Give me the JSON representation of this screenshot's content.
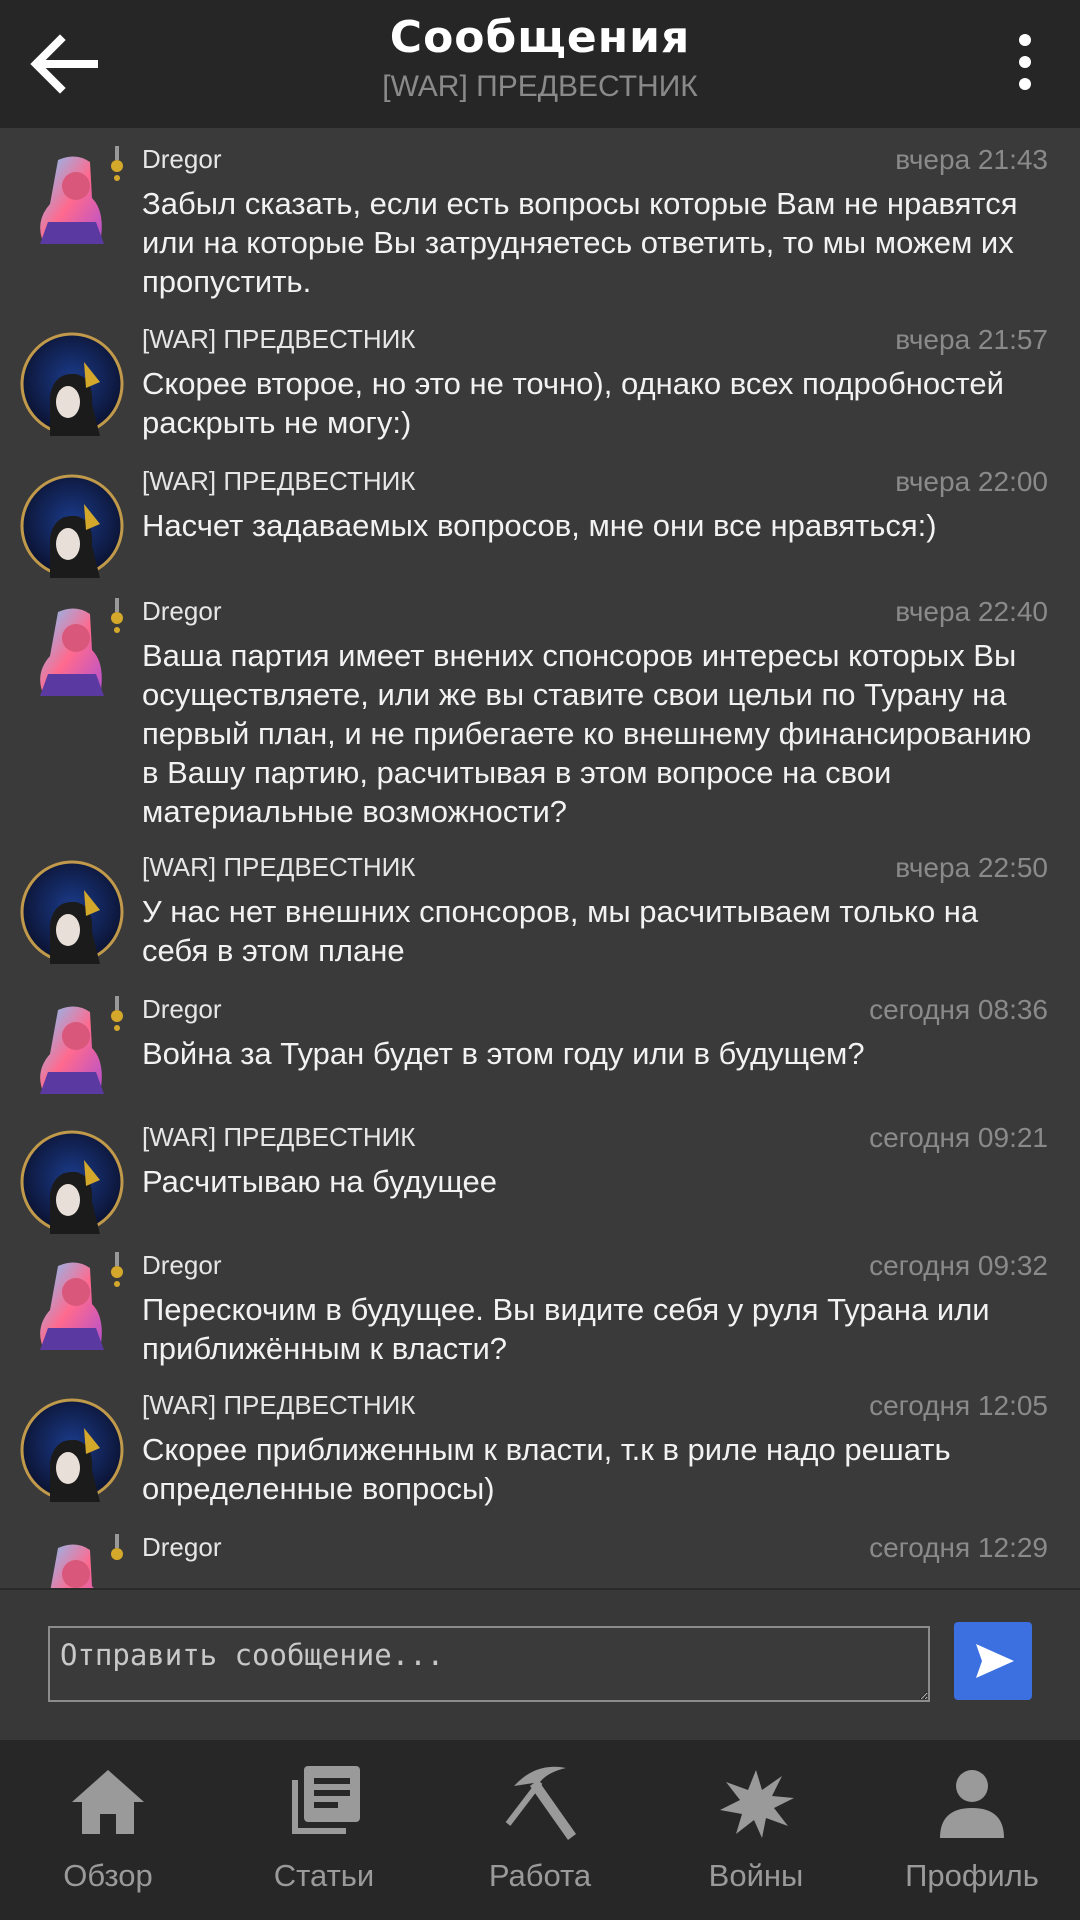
{
  "header": {
    "title": "Сообщения",
    "subtitle": "[WAR] ПРЕДВЕСТНИК",
    "back_icon": "arrow-left-icon",
    "menu_icon": "more-vertical-icon"
  },
  "messages": [
    {
      "author": "Dregor",
      "time": "вчера 21:43",
      "text": "Забыл сказать, если есть вопросы которые Вам не нравятся или на которые Вы затрудняетесь ответить, то мы можем их пропустить."
    },
    {
      "author": "[WAR] ПРЕДВЕСТНИК",
      "time": "вчера 21:57",
      "text": "Скорее второе, но это не точно), однако всех подробностей раскрыть не могу:)"
    },
    {
      "author": "[WAR] ПРЕДВЕСТНИК",
      "time": "вчера 22:00",
      "text": "Насчет задаваемых вопросов, мне они все нравяться:)"
    },
    {
      "author": "Dregor",
      "time": "вчера 22:40",
      "text": "Ваша партия имеет внених спонсоров интересы которых Вы осуществляете, или же вы ставите свои цельи по Турану на первый план, и не прибегаете ко внешнему финансированию в Вашу партию, расчитывая в этом вопросе на свои материальные возможности?"
    },
    {
      "author": "[WAR] ПРЕДВЕСТНИК",
      "time": "вчера 22:50",
      "text": "У нас нет внешних спонсоров, мы расчитываем только на себя в этом плане"
    },
    {
      "author": "Dregor",
      "time": "сегодня 08:36",
      "text": "Война за Туран будет в этом году или в будущем?"
    },
    {
      "author": "[WAR] ПРЕДВЕСТНИК",
      "time": "сегодня 09:21",
      "text": "Расчитываю на будущее"
    },
    {
      "author": "Dregor",
      "time": "сегодня 09:32",
      "text": "Перескочим в будущее. Вы видите себя у руля Турана или приближённым к власти?"
    },
    {
      "author": "[WAR] ПРЕДВЕСТНИК",
      "time": "сегодня 12:05",
      "text": "Скорее приближенным к власти, т.к в риле надо решать определенные вопросы)"
    },
    {
      "author": "Dregor",
      "time": "сегодня 12:29",
      "text": ""
    }
  ],
  "composer": {
    "placeholder": "Отправить сообщение...",
    "send_icon": "send-icon"
  },
  "nav": [
    {
      "label": "Обзор",
      "icon": "home-icon"
    },
    {
      "label": "Статьи",
      "icon": "articles-icon"
    },
    {
      "label": "Работа",
      "icon": "pickaxe-icon"
    },
    {
      "label": "Войны",
      "icon": "explosion-icon"
    },
    {
      "label": "Профиль",
      "icon": "person-icon"
    }
  ],
  "colors": {
    "background": "#3a3a3a",
    "header": "#262626",
    "accent": "#3c6fe0",
    "muted_text": "#8a8a8a"
  }
}
